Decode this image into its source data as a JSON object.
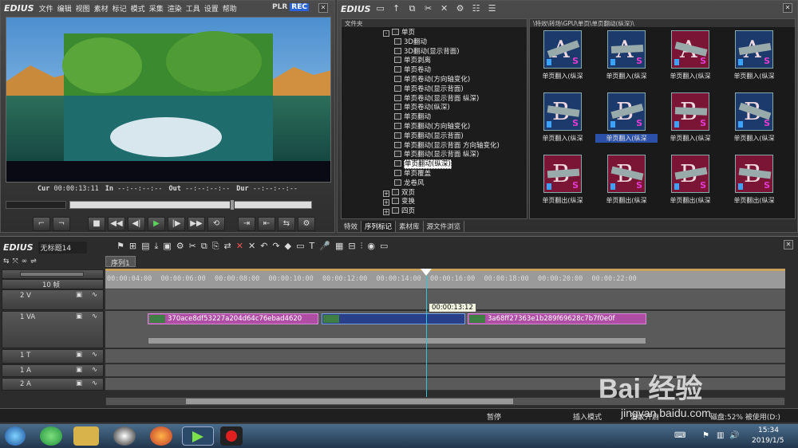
{
  "player": {
    "brand": "EDIUS",
    "menu": [
      "文件",
      "编辑",
      "视图",
      "素材",
      "标记",
      "模式",
      "采集",
      "渲染",
      "工具",
      "设置",
      "帮助"
    ],
    "plr": "PLR",
    "rec": "REC",
    "cur_label": "Cur",
    "cur_value": "00:00:13:11",
    "in_label": "In",
    "in_value": "--:--:--:--",
    "out_label": "Out",
    "out_value": "--:--:--:--",
    "dur_label": "Dur",
    "dur_value": "--:--:--:--"
  },
  "library": {
    "brand": "EDIUS",
    "folder_header": "文件夹",
    "path": "\\特效\\转场\\GPU\\单页\\单页翻动(纵深)\\",
    "tree": [
      {
        "label": "单页",
        "indent": 0,
        "expander": "-"
      },
      {
        "label": "3D翻动",
        "indent": 1
      },
      {
        "label": "3D翻动(显示背面)",
        "indent": 1
      },
      {
        "label": "单页剥离",
        "indent": 1
      },
      {
        "label": "单页卷动",
        "indent": 1
      },
      {
        "label": "单页卷动(方向轴变化)",
        "indent": 1
      },
      {
        "label": "单页卷动(显示背面)",
        "indent": 1
      },
      {
        "label": "单页卷动(显示背面 纵深)",
        "indent": 1
      },
      {
        "label": "单页卷动(纵深)",
        "indent": 1
      },
      {
        "label": "单页翻动",
        "indent": 1
      },
      {
        "label": "单页翻动(方向轴变化)",
        "indent": 1
      },
      {
        "label": "单页翻动(显示背面)",
        "indent": 1
      },
      {
        "label": "单页翻动(显示背面 方向轴变化)",
        "indent": 1
      },
      {
        "label": "单页翻动(显示背面 纵深)",
        "indent": 1
      },
      {
        "label": "单页翻动(纵深)",
        "indent": 1,
        "selected": true
      },
      {
        "label": "单页覆盖",
        "indent": 1
      },
      {
        "label": "龙卷风",
        "indent": 1
      },
      {
        "label": "双页",
        "indent": 0,
        "expander": "+"
      },
      {
        "label": "变换",
        "indent": 0,
        "expander": "+"
      },
      {
        "label": "四页",
        "indent": 0,
        "expander": "+"
      }
    ],
    "thumbs": [
      {
        "caption": "单页翻入(纵深",
        "letter": "A",
        "style": "blue"
      },
      {
        "caption": "单页翻入(纵深",
        "letter": "A",
        "style": "blue"
      },
      {
        "caption": "单页翻入(纵深",
        "letter": "A",
        "style": "red"
      },
      {
        "caption": "单页翻入(纵深",
        "letter": "A",
        "style": "blue"
      },
      {
        "caption": "单页翻入(纵深",
        "letter": "B",
        "style": "blue"
      },
      {
        "caption": "单页翻入(纵深",
        "letter": "B",
        "style": "blue",
        "selected": true
      },
      {
        "caption": "单页翻入(纵深",
        "letter": "B",
        "style": "red"
      },
      {
        "caption": "单页翻入(纵深",
        "letter": "B",
        "style": "blue"
      },
      {
        "caption": "单页翻出(纵深",
        "letter": "B",
        "style": "red"
      },
      {
        "caption": "单页翻出(纵深",
        "letter": "B",
        "style": "red"
      },
      {
        "caption": "单页翻出(纵深",
        "letter": "B",
        "style": "red"
      },
      {
        "caption": "单页翻出(纵深",
        "letter": "B",
        "style": "red"
      }
    ],
    "bottom_tabs": [
      "特效",
      "序列标记",
      "素材库",
      "源文件浏览"
    ]
  },
  "timeline": {
    "brand": "EDIUS",
    "project": "无标题14",
    "sequence_tab": "序列1",
    "zoom": "10 帧",
    "ruler": [
      "00:00:04:00",
      "00:00:06:00",
      "00:00:08:00",
      "00:00:10:00",
      "00:00:12:00",
      "00:00:14:00",
      "00:00:16:00",
      "00:00:18:00",
      "00:00:20:00",
      "00:00:22:00"
    ],
    "cursor_tooltip": "00:00:13:12",
    "tracks": [
      {
        "name": "2 V"
      },
      {
        "name": "1 VA"
      },
      {
        "name": "1 T"
      },
      {
        "name": "1 A"
      },
      {
        "name": "2 A"
      }
    ],
    "clip1": "370ace8df53227a204d64c76ebad4620",
    "clip2": "3a68ff27363e1b289f69628c7b7f0e0f"
  },
  "status": {
    "pause": "暂停",
    "insert_mode": "插入模式",
    "ripple": "波纹开启",
    "disk": "磁盘:52% 被使用(D:)"
  },
  "taskbar": {
    "time": "15:34",
    "date": "2019/1/5"
  },
  "watermark": {
    "brand": "Bai 经验",
    "url": "jingyan.baidu.com"
  }
}
